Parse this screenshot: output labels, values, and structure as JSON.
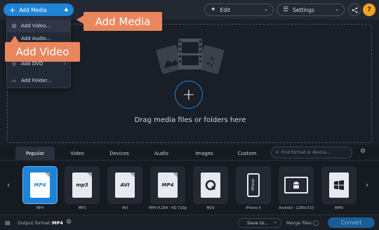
{
  "topbar": {
    "add_media_label": "Add Media",
    "edit_label": "Edit",
    "settings_label": "Settings",
    "help_label": "?"
  },
  "add_media_menu": {
    "items": [
      {
        "label": "Add Video...",
        "icon": "film-icon"
      },
      {
        "label": "Add Audio...",
        "icon": "music-icon"
      },
      {
        "label": "",
        "icon": "image-icon"
      },
      {
        "label": "Add DVD",
        "icon": "disc-icon",
        "has_submenu": true
      },
      {
        "label": "Add Folder...",
        "icon": "folder-icon"
      }
    ]
  },
  "callouts": {
    "add_media": "Add Media",
    "add_video": "Add Video"
  },
  "dropzone": {
    "text": "Drag media files or folders here"
  },
  "format_tabs": [
    "Popular",
    "Video",
    "Devices",
    "Audio",
    "Images",
    "Custom"
  ],
  "selected_tab": "Popular",
  "search": {
    "placeholder": "Find format or device..."
  },
  "formats": [
    {
      "badge": "MP4",
      "label": "MP4",
      "selected": true
    },
    {
      "badge": "mp3",
      "label": "MP3"
    },
    {
      "badge": "AVI",
      "label": "AVI"
    },
    {
      "badge": "MP4",
      "label": "MP4 H.264 - HD 720p"
    },
    {
      "badge": "",
      "label": "MOV"
    },
    {
      "badge": "iPhone",
      "label": "iPhone X"
    },
    {
      "badge": "",
      "label": "Android - 1280x720"
    },
    {
      "badge": "",
      "label": "WMV"
    }
  ],
  "bottombar": {
    "output_format_label": "Output format:",
    "output_format_value": "MP4",
    "save_to_label": "Save to...",
    "merge_files_label": "Merge files:",
    "convert_label": "Convert"
  },
  "colors": {
    "accent": "#1f84d6",
    "callout": "#e9865e",
    "help": "#f0a321",
    "background": "#1a1e26"
  }
}
